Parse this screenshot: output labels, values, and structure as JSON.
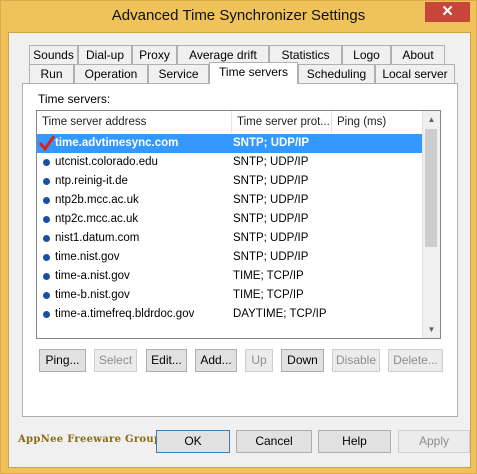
{
  "window": {
    "title": "Advanced Time Synchronizer Settings",
    "close_glyph": "✕"
  },
  "tabs_row_back": [
    {
      "label": "Sounds"
    },
    {
      "label": "Dial-up"
    },
    {
      "label": "Proxy"
    },
    {
      "label": "Average drift"
    },
    {
      "label": "Statistics"
    },
    {
      "label": "Logo"
    },
    {
      "label": "About"
    }
  ],
  "tabs_row_front": [
    {
      "label": "Run"
    },
    {
      "label": "Operation"
    },
    {
      "label": "Service"
    },
    {
      "label": "Time servers"
    },
    {
      "label": "Scheduling"
    },
    {
      "label": "Local server"
    }
  ],
  "active_tab": "Time servers",
  "group_label": "Time servers:",
  "columns": {
    "address": "Time server address",
    "protocol": "Time server prot...",
    "ping": "Ping (ms)"
  },
  "servers": [
    {
      "address": "time.advtimesync.com",
      "protocol": "SNTP; UDP/IP",
      "icon": "red-check-icon",
      "selected": true
    },
    {
      "address": "utcnist.colorado.edu",
      "protocol": "SNTP; UDP/IP",
      "icon": "blue-dot-icon"
    },
    {
      "address": "ntp.reinig-it.de",
      "protocol": "SNTP; UDP/IP",
      "icon": "blue-dot-icon"
    },
    {
      "address": "ntp2b.mcc.ac.uk",
      "protocol": "SNTP; UDP/IP",
      "icon": "blue-dot-icon"
    },
    {
      "address": "ntp2c.mcc.ac.uk",
      "protocol": "SNTP; UDP/IP",
      "icon": "blue-dot-icon"
    },
    {
      "address": "nist1.datum.com",
      "protocol": "SNTP; UDP/IP",
      "icon": "blue-dot-icon"
    },
    {
      "address": "time.nist.gov",
      "protocol": "SNTP; UDP/IP",
      "icon": "blue-dot-icon"
    },
    {
      "address": "time-a.nist.gov",
      "protocol": "TIME; TCP/IP",
      "icon": "blue-dot-icon"
    },
    {
      "address": "time-b.nist.gov",
      "protocol": "TIME; TCP/IP",
      "icon": "blue-dot-icon"
    },
    {
      "address": "time-a.timefreq.bldrdoc.gov",
      "protocol": "DAYTIME; TCP/IP",
      "icon": "blue-dot-icon"
    }
  ],
  "list_buttons": {
    "ping": "Ping...",
    "select": "Select",
    "edit": "Edit...",
    "add": "Add...",
    "up": "Up",
    "down": "Down",
    "disable": "Disable",
    "delete": "Delete..."
  },
  "dialog_buttons": {
    "ok": "OK",
    "cancel": "Cancel",
    "help": "Help",
    "apply": "Apply"
  },
  "brand_text": "AppNee Freeware Group.",
  "colors": {
    "frame": "#f0c35a",
    "selection": "#3399ff",
    "close": "#c7453a",
    "brand": "#8a6b12"
  }
}
